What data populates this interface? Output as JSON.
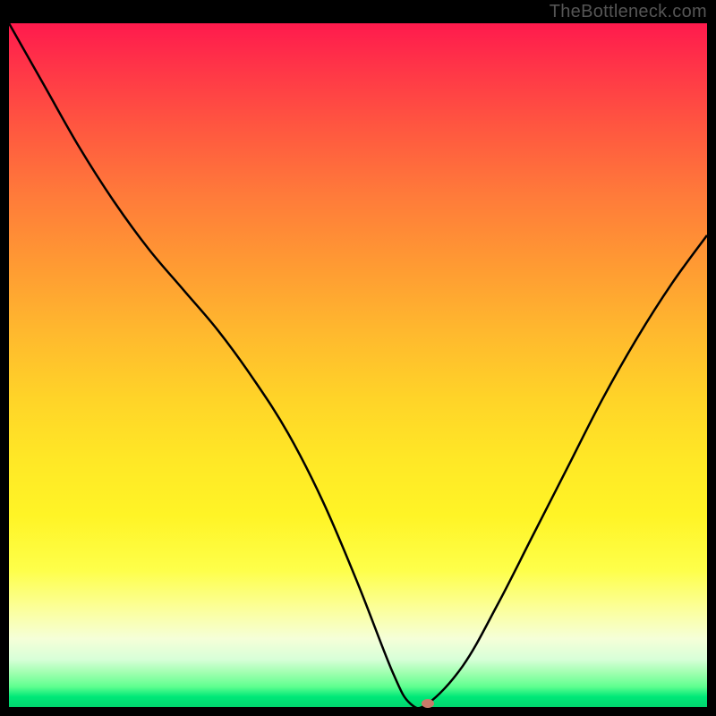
{
  "watermark": "TheBottleneck.com",
  "chart_data": {
    "type": "line",
    "title": "",
    "xlabel": "",
    "ylabel": "",
    "x": [
      0.0,
      0.05,
      0.1,
      0.15,
      0.2,
      0.25,
      0.3,
      0.35,
      0.4,
      0.45,
      0.5,
      0.55,
      0.575,
      0.6,
      0.65,
      0.7,
      0.75,
      0.8,
      0.85,
      0.9,
      0.95,
      1.0
    ],
    "values": [
      1.0,
      0.91,
      0.82,
      0.74,
      0.67,
      0.61,
      0.55,
      0.48,
      0.4,
      0.3,
      0.18,
      0.05,
      0.005,
      0.005,
      0.06,
      0.15,
      0.25,
      0.35,
      0.45,
      0.54,
      0.62,
      0.69
    ],
    "xlim": [
      0,
      1
    ],
    "ylim": [
      0,
      1
    ],
    "marker_point": {
      "x": 0.6,
      "y": 0.005
    },
    "grid": false,
    "legend": false,
    "background": "rainbow-gradient-vertical"
  },
  "colors": {
    "frame": "#000000",
    "curve": "#000000",
    "marker": "#c97a6a"
  }
}
